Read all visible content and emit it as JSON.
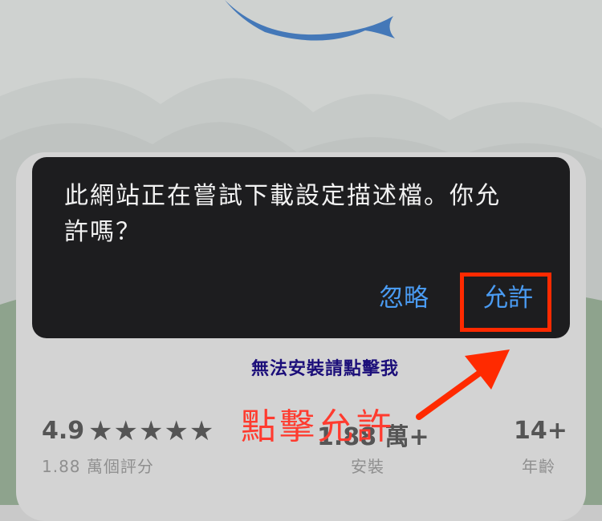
{
  "dialog": {
    "message_line1": "此網站正在嘗試下載設定描述檔。你允",
    "message_line2": "許嗎？",
    "ignore_label": "忽略",
    "allow_label": "允許"
  },
  "help_link": "無法安裝請點擊我",
  "stats": {
    "rating": "4.9",
    "stars": "★★★★★",
    "rating_count": "1.88 萬個評分",
    "installs": "1.88 萬+",
    "installs_label": "安裝",
    "age": "14+",
    "age_label": "年齡"
  },
  "annotation": "點擊允許",
  "colors": {
    "dialog_bg": "#1d1d1f",
    "button_blue": "#4a9bf2",
    "highlight_red": "#ff2a00",
    "link_purple": "#1c0f7a"
  }
}
